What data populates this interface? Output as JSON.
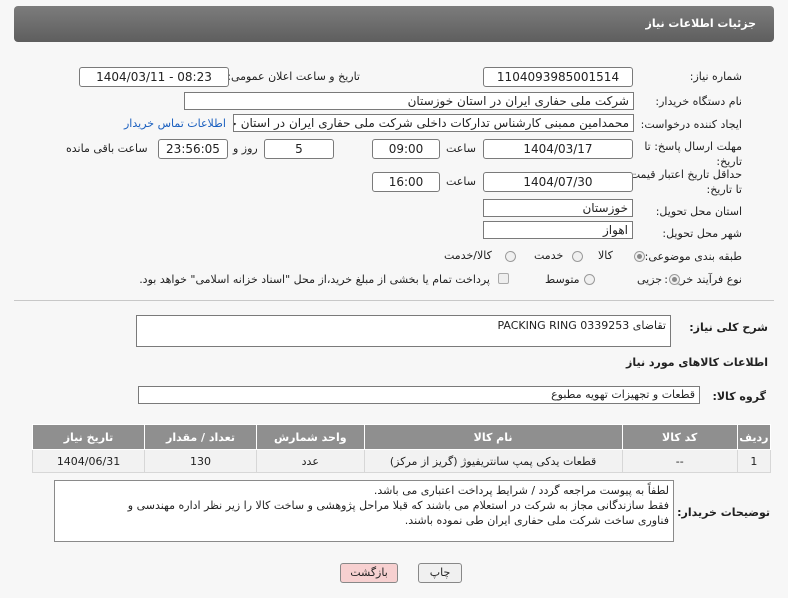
{
  "header": {
    "title": "جزئیات اطلاعات نیاز"
  },
  "fields": {
    "need_number_label": "شماره نیاز:",
    "need_number": "1104093985001514",
    "announce_label": "تاریخ و ساعت اعلان عمومی:",
    "announce_value": "1404/03/11 - 08:23",
    "buyer_org_label": "نام دستگاه خریدار:",
    "buyer_org": "شرکت ملی حفاری ایران در استان خوزستان",
    "creator_label": "ایجاد کننده درخواست:",
    "creator": "محمدامین ممبنی کارشناس تدارکات داخلی شرکت ملی حفاری ایران در استان خوزستان",
    "contact_link": "اطلاعات تماس خریدار",
    "reply_deadline_label": "مهلت ارسال پاسخ: تا تاریخ:",
    "reply_date": "1404/03/17",
    "time_label": "ساعت",
    "reply_time": "09:00",
    "days": "5",
    "days_label": "روز و",
    "remaining_time": "23:56:05",
    "remaining_label": "ساعت باقی مانده",
    "price_valid_label": "حداقل تاریخ اعتبار قیمت: تا تاریخ:",
    "price_date": "1404/07/30",
    "price_time": "16:00",
    "province_label": "استان محل تحویل:",
    "province": "خوزستان",
    "city_label": "شهر محل تحویل:",
    "city": "اهواز",
    "category_label": "طبقه بندی موضوعی:",
    "cat_goods": "کالا",
    "cat_service": "خدمت",
    "cat_goods_service": "کالا/خدمت",
    "process_label": "نوع فرآیند خرید :",
    "proc_minor": "جزیی",
    "proc_medium": "متوسط",
    "payment_note": "پرداخت تمام یا بخشی از مبلغ خرید،از محل \"اسناد خزانه اسلامی\" خواهد بود."
  },
  "description": {
    "label": "شرح کلی نیاز:",
    "value": "تقاضای PACKING RING 0339253"
  },
  "goods_section": {
    "title": "اطلاعات کالاهای مورد نیاز",
    "group_label": "گروه کالا:",
    "group_value": "قطعات و تجهیزات تهویه مطبوع"
  },
  "table": {
    "headers": [
      "ردیف",
      "کد کالا",
      "نام کالا",
      "واحد شمارش",
      "تعداد / مقدار",
      "تاریخ نیاز"
    ],
    "rows": [
      [
        "1",
        "--",
        "قطعات یدکی پمپ سانتریفیوژ (گریز از مرکز)",
        "عدد",
        "130",
        "1404/06/31"
      ]
    ]
  },
  "notes": {
    "label": "توضیحات خریدار:",
    "line1": "لطفاً به پیوست مراجعه گردد / شرایط پرداخت اعتباری می باشد.",
    "line2": "فقط سازندگانی مجاز به شرکت در استعلام می باشند که قبلا مراحل پژوهشی و ساخت کالا را زیر نظر اداره مهندسی و",
    "line3": "فناوری ساخت شرکت ملی حفاری ایران طی نموده باشند."
  },
  "buttons": {
    "print": "چاپ",
    "back": "بازگشت"
  },
  "colors": {
    "header": "#6b6b6b",
    "link": "#1a5fbf",
    "back_button": "#f7d0d0"
  }
}
